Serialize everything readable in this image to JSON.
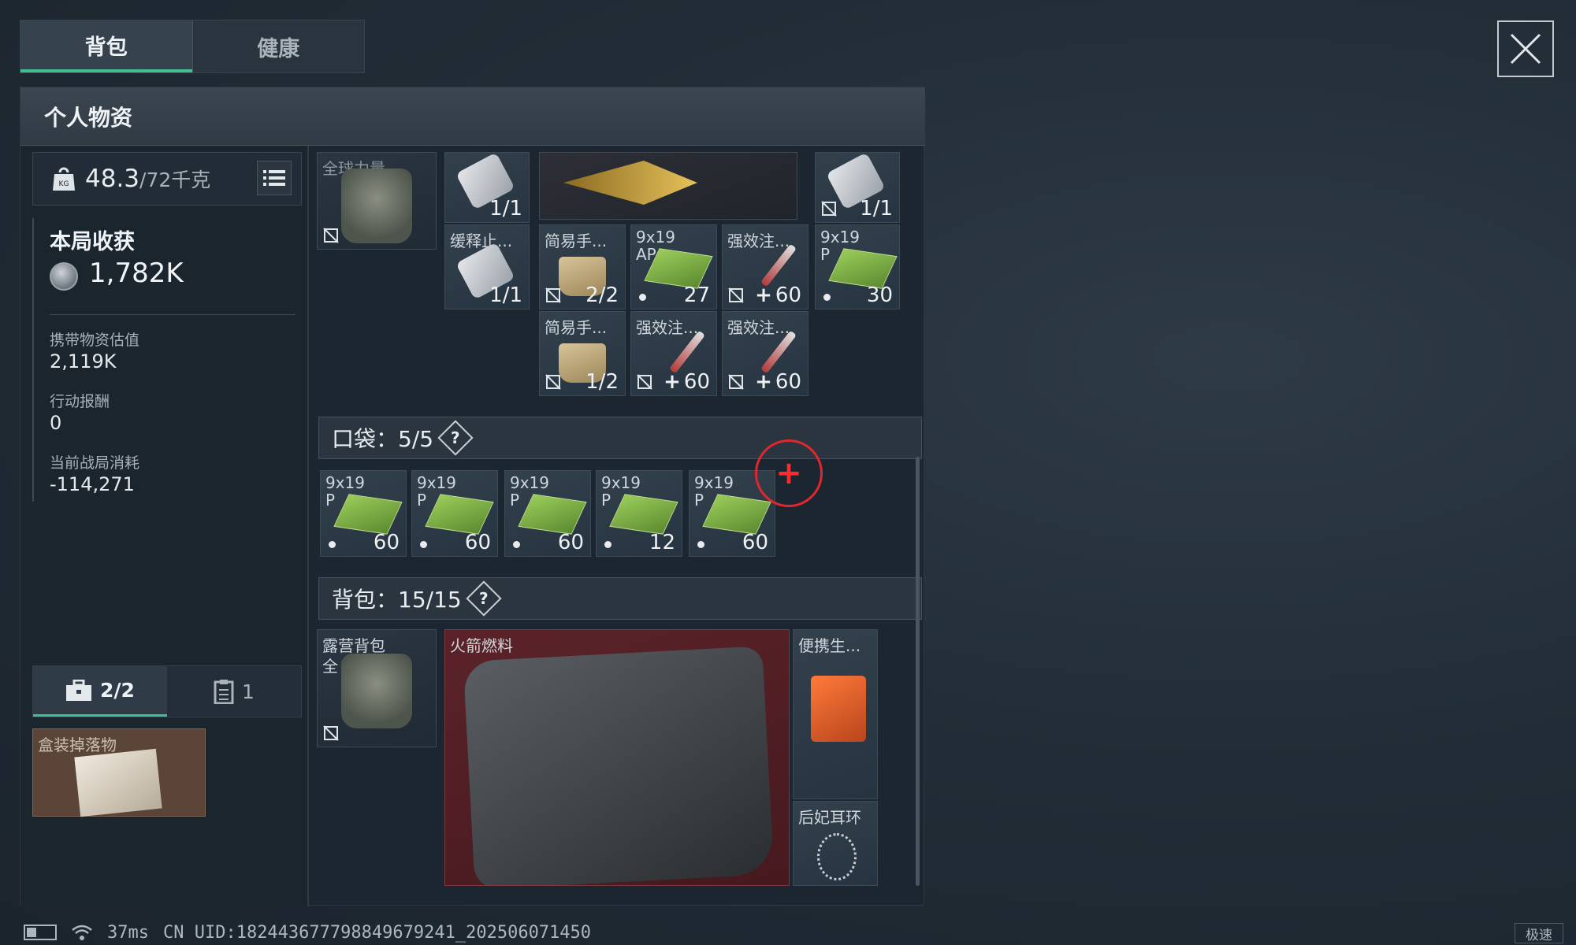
{
  "tabs": [
    {
      "label": "背包"
    },
    {
      "label": "健康"
    }
  ],
  "panel": {
    "title": "个人物资"
  },
  "weight": {
    "current": "48.3",
    "max": "/72千克"
  },
  "harvest": {
    "title": "本局收获",
    "total": "1,782K",
    "stats": [
      {
        "label": "携带物资估值",
        "value": "2,119K"
      },
      {
        "label": "行动报酬",
        "value": "0"
      },
      {
        "label": "当前战局消耗",
        "value": "-114,271"
      }
    ]
  },
  "container_tabs": [
    {
      "label": "2/2",
      "icon": "briefcase-icon"
    },
    {
      "label": "1",
      "icon": "clipboard-icon"
    }
  ],
  "secure_box": {
    "name": "盒装掉落物"
  },
  "vest_items": [
    {
      "name": "缓释止...",
      "count": "1/1"
    },
    {
      "name": "缓释止...",
      "count": "1/1"
    },
    {
      "name": "简易手...",
      "count": "2/2"
    },
    {
      "name": "简易手...",
      "count": "1/2"
    },
    {
      "name": "9x19 AP",
      "count": "27"
    },
    {
      "name": "强效注...",
      "count": "60"
    },
    {
      "name": "强效注...",
      "count": "60"
    },
    {
      "name": "强效注...",
      "count": "60"
    },
    {
      "name": "9x19 P",
      "count": "30"
    },
    {
      "name": "缓释止...",
      "count": "1/1"
    }
  ],
  "vest": {
    "name": "全球力量"
  },
  "pockets": {
    "label": "口袋：5/5",
    "items": [
      {
        "name": "9x19 P",
        "count": "60"
      },
      {
        "name": "9x19 P",
        "count": "60"
      },
      {
        "name": "9x19 P",
        "count": "60"
      },
      {
        "name": "9x19 P",
        "count": "12"
      },
      {
        "name": "9x19 P",
        "count": "60"
      }
    ]
  },
  "backpack": {
    "label": "背包：15/15",
    "bag": "露营背包",
    "bag_sub": "全",
    "rocket_fuel": "火箭燃料",
    "generator": "便携生...",
    "earrings": "后妃耳环"
  },
  "status": {
    "ping": "37ms",
    "uid": "CN UID:18244367779884967924​1_202506071450",
    "speed": "极速"
  }
}
